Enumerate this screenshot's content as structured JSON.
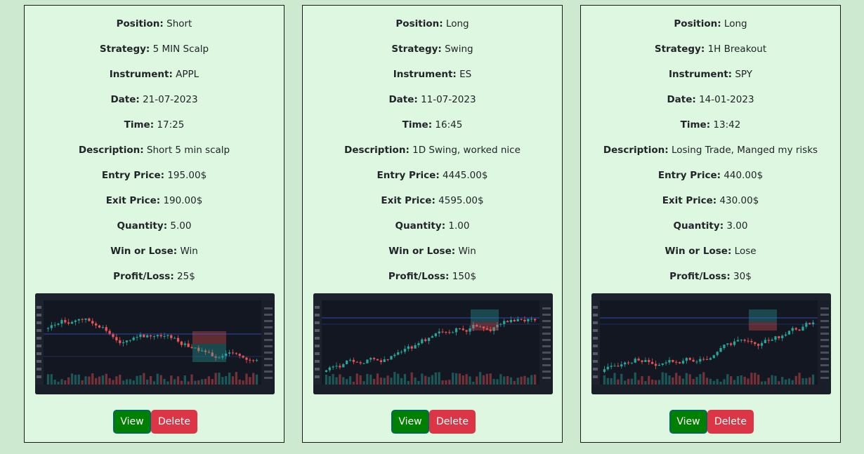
{
  "labels": {
    "position": "Position:",
    "strategy": "Strategy:",
    "instrument": "Instrument:",
    "date": "Date:",
    "time": "Time:",
    "description": "Description:",
    "entry": "Entry Price:",
    "exit": "Exit Price:",
    "quantity": "Quantity:",
    "win": "Win or Lose:",
    "pl": "Profit/Loss:"
  },
  "buttons": {
    "view": "View",
    "delete": "Delete"
  },
  "colors": {
    "up": "#26a69a",
    "down": "#ef5350",
    "chart_bg": "#131722"
  },
  "trades": [
    {
      "position": "Short",
      "strategy": "5 MIN Scalp",
      "instrument": "APPL",
      "date": "21-07-2023",
      "time": "17:25",
      "description": "Short 5 min scalp",
      "entry": "195.00$",
      "exit": "190.00$",
      "quantity": "5.00",
      "win": "Win",
      "pl": "25$"
    },
    {
      "position": "Long",
      "strategy": "Swing",
      "instrument": "ES",
      "date": "11-07-2023",
      "time": "16:45",
      "description": "1D Swing, worked nice",
      "entry": "4445.00$",
      "exit": "4595.00$",
      "quantity": "1.00",
      "win": "Win",
      "pl": "150$"
    },
    {
      "position": "Long",
      "strategy": "1H Breakout",
      "instrument": "SPY",
      "date": "14-01-2023",
      "time": "13:42",
      "description": "Losing Trade, Manged my risks",
      "entry": "440.00$",
      "exit": "430.00$",
      "quantity": "3.00",
      "win": "Lose",
      "pl": "30$"
    }
  ]
}
